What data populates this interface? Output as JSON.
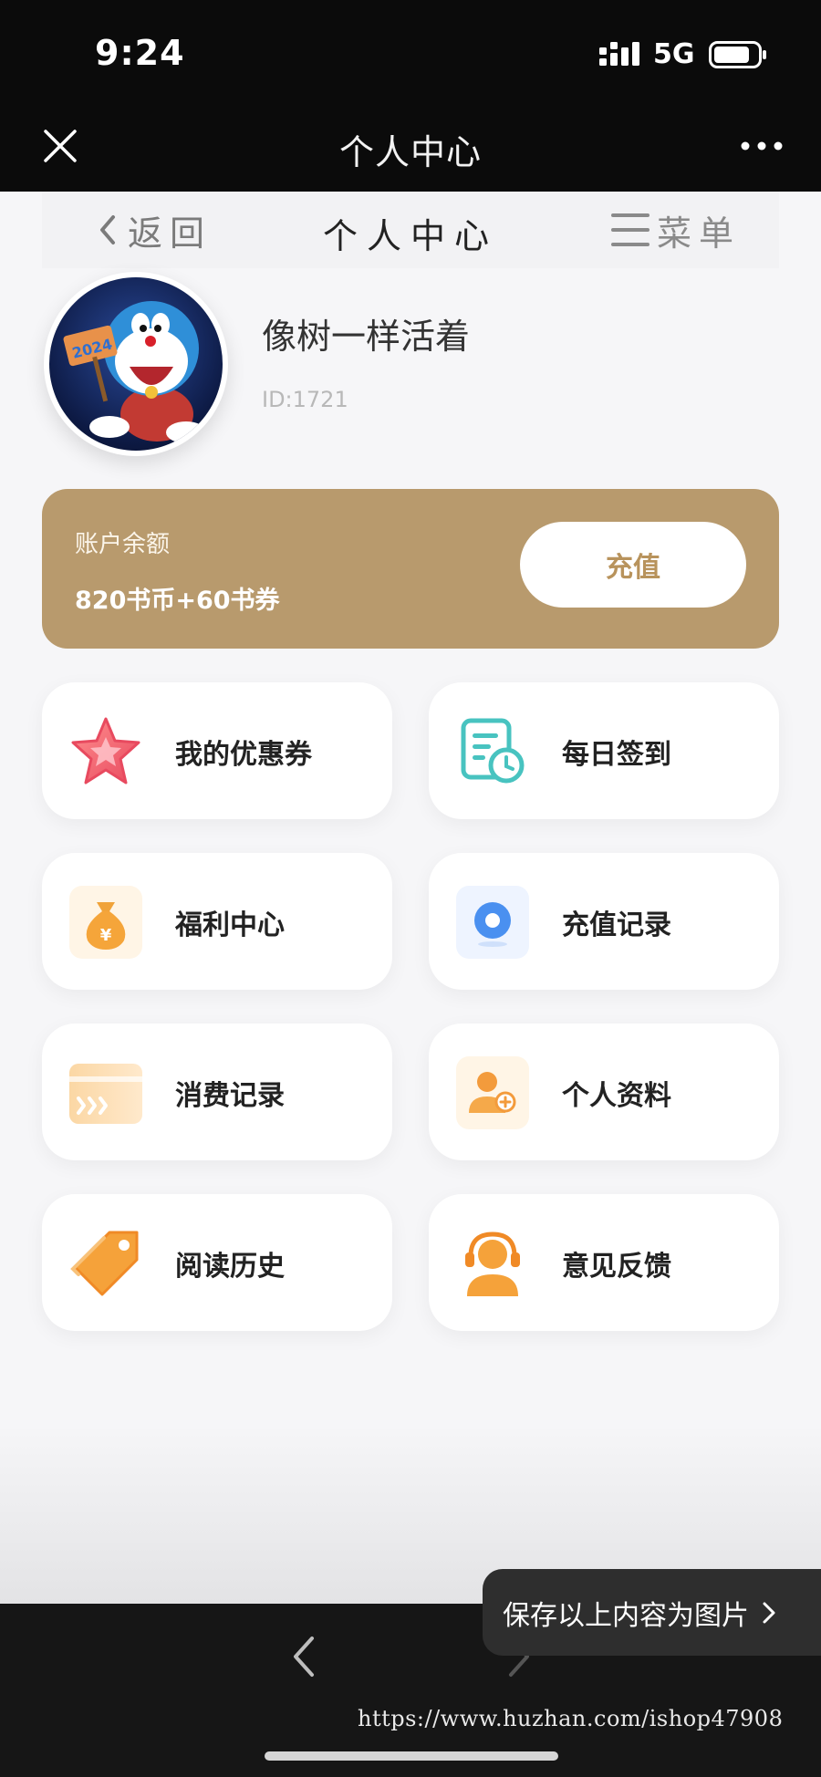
{
  "status_bar": {
    "time": "9:24",
    "network": "5G"
  },
  "webview": {
    "title": "个人中心"
  },
  "header": {
    "back_label": "返回",
    "title": "个人中心",
    "menu_label": "菜单"
  },
  "profile": {
    "username": "像树一样活着",
    "user_id": "ID:1721",
    "avatar_badge": "2024"
  },
  "balance": {
    "label": "账户余额",
    "value": "820书币+60书券",
    "recharge_label": "充值"
  },
  "menu_items": [
    {
      "label": "我的优惠券",
      "icon": "star-icon"
    },
    {
      "label": "每日签到",
      "icon": "calendar-clock-icon"
    },
    {
      "label": "福利中心",
      "icon": "money-bag-icon"
    },
    {
      "label": "充值记录",
      "icon": "coin-icon"
    },
    {
      "label": "消费记录",
      "icon": "card-icon"
    },
    {
      "label": "个人资料",
      "icon": "user-add-icon"
    },
    {
      "label": "阅读历史",
      "icon": "tag-icon"
    },
    {
      "label": "意见反馈",
      "icon": "headset-icon"
    }
  ],
  "save_toast": {
    "label": "保存以上内容为图片"
  },
  "watermark": "https://www.huzhan.com/ishop47908",
  "colors": {
    "accent": "#b89a6d",
    "accent_text": "#b8935c",
    "dark": "#0b0b0b"
  }
}
